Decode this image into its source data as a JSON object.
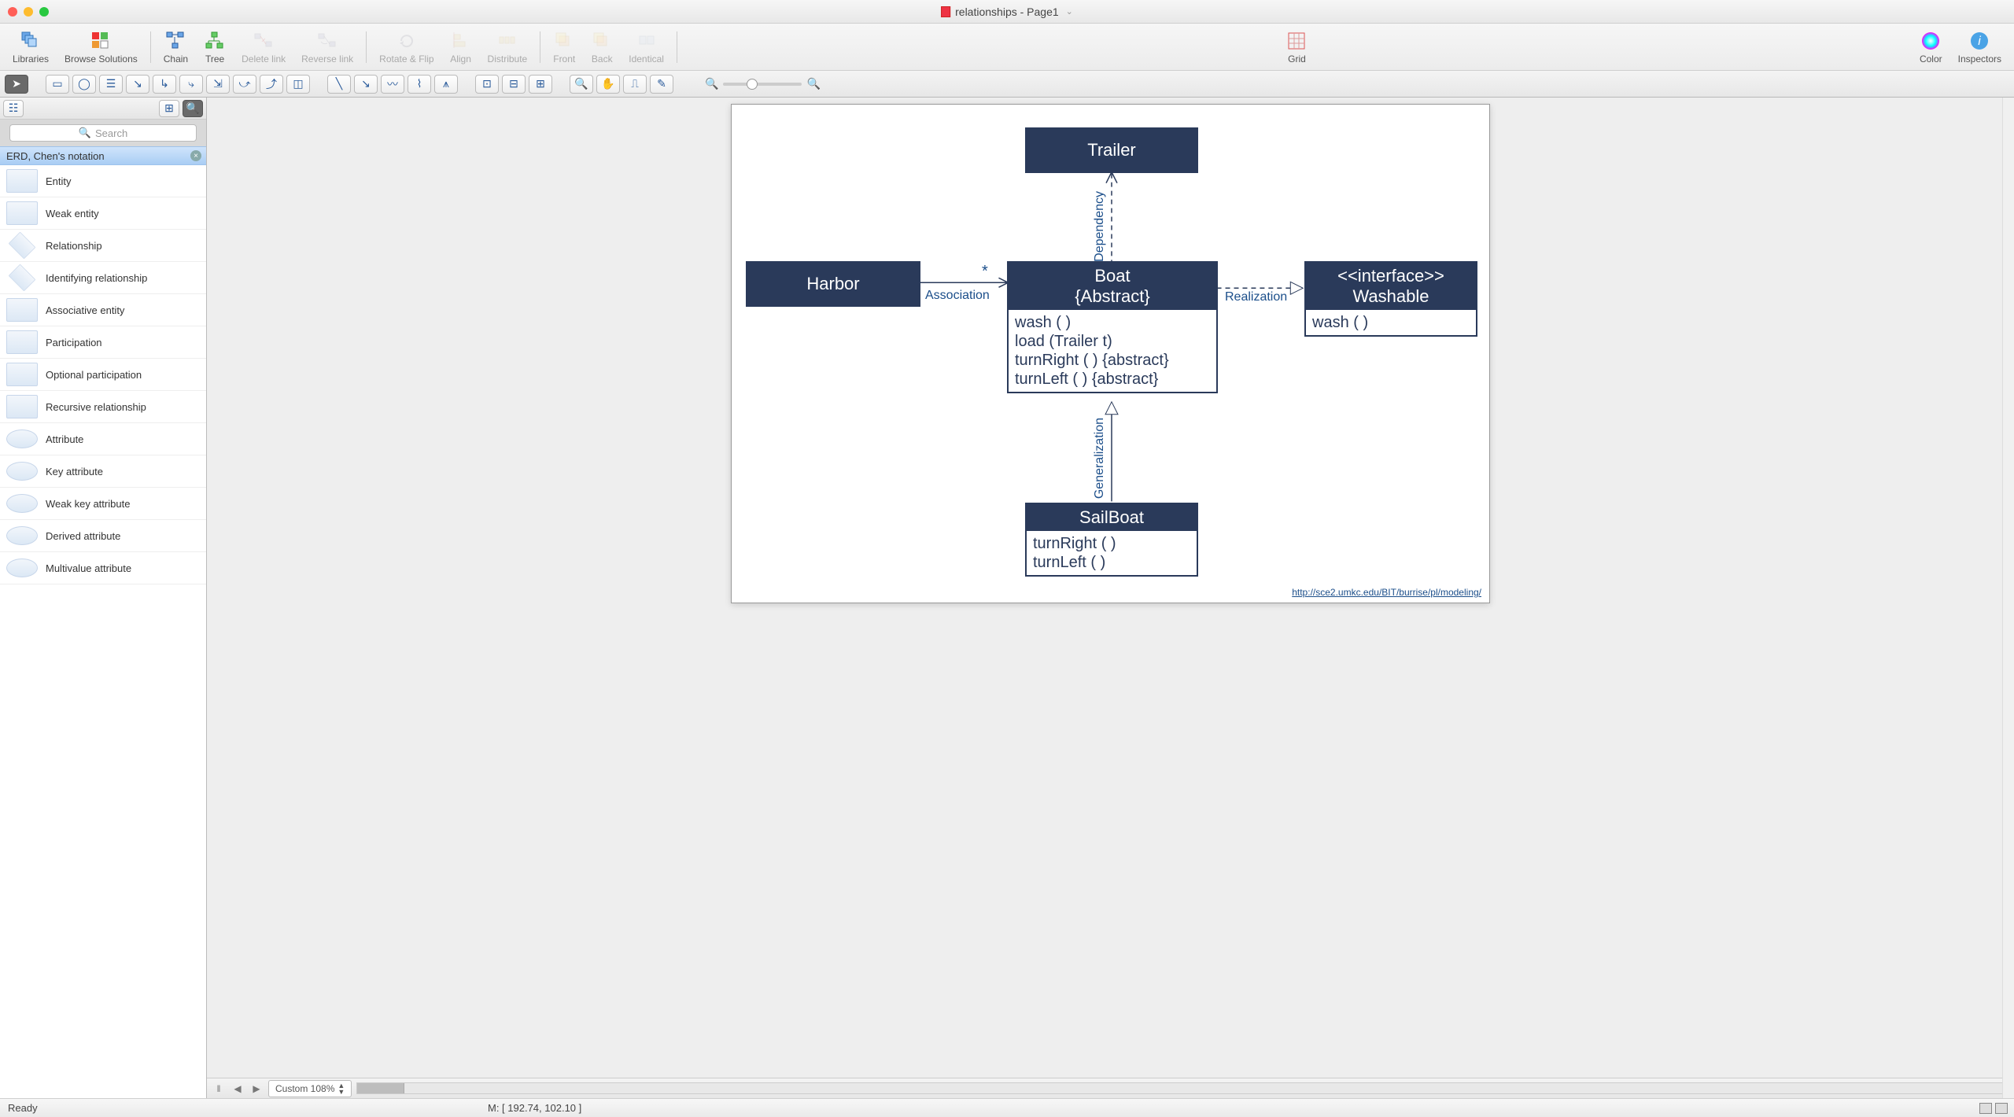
{
  "window": {
    "title": "relationships - Page1"
  },
  "toolbar": {
    "libraries": "Libraries",
    "browse": "Browse Solutions",
    "chain": "Chain",
    "tree": "Tree",
    "delete_link": "Delete link",
    "reverse_link": "Reverse link",
    "rotate_flip": "Rotate & Flip",
    "align": "Align",
    "distribute": "Distribute",
    "front": "Front",
    "back": "Back",
    "identical": "Identical",
    "grid": "Grid",
    "color": "Color",
    "inspectors": "Inspectors"
  },
  "sidebar": {
    "search_placeholder": "Search",
    "section_title": "ERD, Chen's notation",
    "shapes": [
      "Entity",
      "Weak entity",
      "Relationship",
      "Identifying relationship",
      "Associative entity",
      "Participation",
      "Optional participation",
      "Recursive relationship",
      "Attribute",
      "Key attribute",
      "Weak key attribute",
      "Derived attribute",
      "Multivalue attribute"
    ]
  },
  "diagram": {
    "trailer": {
      "title": "Trailer"
    },
    "harbor": {
      "title": "Harbor"
    },
    "boat": {
      "title_line1": "Boat",
      "title_line2": "{Abstract}",
      "ops": [
        "wash ( )",
        "load (Trailer t)",
        "turnRight ( ) {abstract}",
        "turnLeft ( ) {abstract}"
      ]
    },
    "washable": {
      "title_line1": "<<interface>>",
      "title_line2": "Washable",
      "ops": [
        "wash ( )"
      ]
    },
    "sailboat": {
      "title": "SailBoat",
      "ops": [
        "turnRight ( )",
        "turnLeft ( )"
      ]
    },
    "labels": {
      "dependency": "Dependency",
      "association": "Association",
      "realization": "Realization",
      "generalization": "Generalization",
      "star": "*"
    },
    "url": "http://sce2.umkc.edu/BIT/burrise/pl/modeling/"
  },
  "page_controls": {
    "zoom_label": "Custom 108%"
  },
  "status": {
    "ready": "Ready",
    "mouse": "M: [ 192.74, 102.10 ]"
  }
}
